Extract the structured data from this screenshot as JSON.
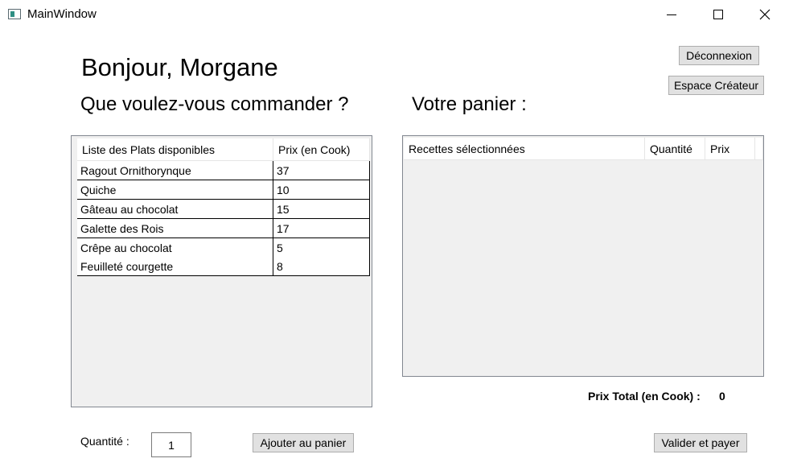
{
  "window": {
    "title": "MainWindow"
  },
  "header": {
    "greeting": "Bonjour, Morgane",
    "order_heading": "Que voulez-vous commander ?",
    "cart_heading": "Votre panier :",
    "logout_label": "Déconnexion",
    "creator_label": "Espace Créateur"
  },
  "dishes": {
    "columns": [
      "Liste des Plats disponibles",
      "Prix (en Cook)"
    ],
    "rows": [
      {
        "name": "Ragout Ornithorynque",
        "price": "37"
      },
      {
        "name": "Quiche",
        "price": "10"
      },
      {
        "name": "Gâteau au chocolat",
        "price": "15"
      },
      {
        "name": "Galette des Rois",
        "price": "17"
      },
      {
        "name": "Crêpe au chocolat",
        "price": "5"
      },
      {
        "name": "Feuilleté courgette",
        "price": "8"
      }
    ]
  },
  "cart": {
    "columns": [
      "Recettes sélectionnées",
      "Quantité",
      "Prix"
    ],
    "total_label": "Prix Total (en Cook) :",
    "total_value": "0"
  },
  "footer": {
    "quantity_label": "Quantité :",
    "quantity_value": "1",
    "add_label": "Ajouter au panier",
    "pay_label": "Valider et payer"
  }
}
